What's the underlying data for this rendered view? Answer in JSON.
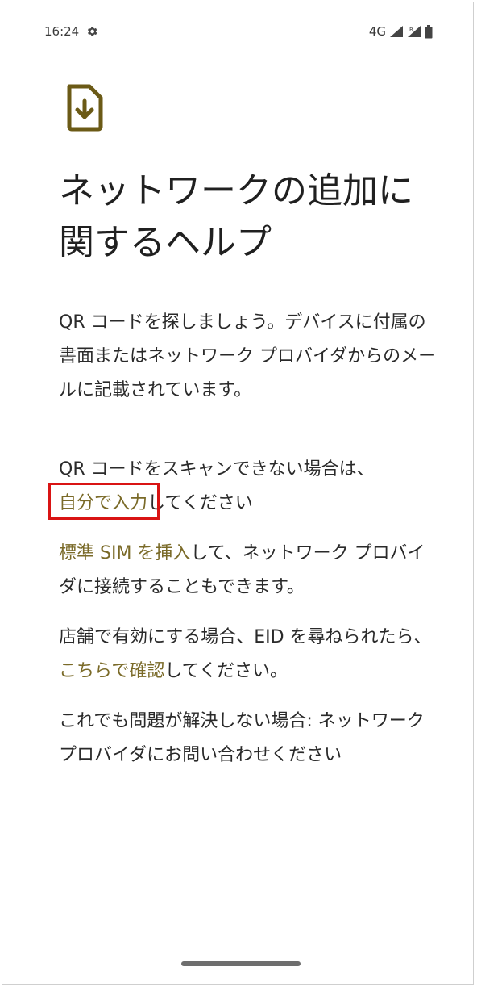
{
  "status_bar": {
    "time": "16:24",
    "network": "4G"
  },
  "title": "ネットワークの追加に関するヘルプ",
  "paragraphs": {
    "p1": "QR コードを探しましょう。デバイスに付属の書面またはネットワーク プロバイダからのメールに記載されています。",
    "p2_pre": "QR コードをスキャンできない場合は、",
    "p2_link": "自分で入力",
    "p2_post": "してください",
    "p3_link": "標準 SIM を挿入",
    "p3_post": "して、ネットワーク プロバイダに接続することもできます。",
    "p4_pre": "店舗で有効にする場合、EID を尋ねられたら、",
    "p4_link": "こちらで確認",
    "p4_post": "してください。",
    "p5": "これでも問題が解決しない場合: ネットワーク プロバイダにお問い合わせください"
  },
  "icons": {
    "settings": "gear-icon",
    "signal": "signal-icon",
    "battery": "battery-icon",
    "sim": "sim-download-icon"
  },
  "colors": {
    "link": "#7a6a28",
    "highlight": "#d91414",
    "icon": "#6b5a16"
  }
}
